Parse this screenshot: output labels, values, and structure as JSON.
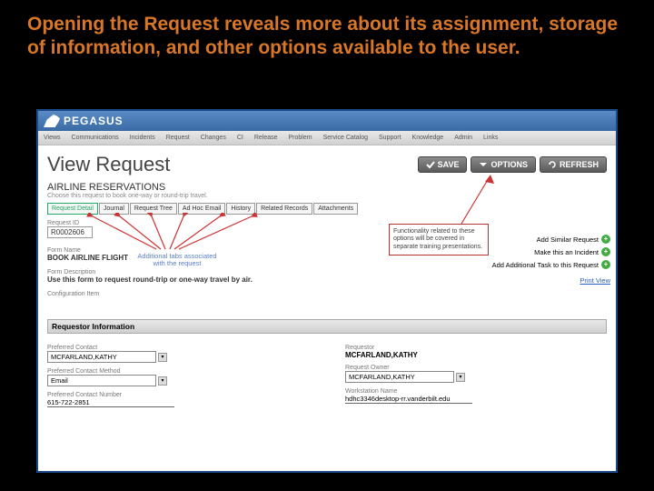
{
  "slide": {
    "title": "Opening the Request reveals more about its assignment, storage of information, and other options available to the user."
  },
  "logo": {
    "text": "PEGASUS"
  },
  "nav": [
    "Views",
    "Communications",
    "Incidents",
    "Request",
    "Changes",
    "CI",
    "Release",
    "Problem",
    "Service Catalog",
    "Support",
    "Knowledge",
    "Admin",
    "Links"
  ],
  "page": {
    "title": "View Request"
  },
  "buttons": {
    "save": "SAVE",
    "options": "OPTIONS",
    "refresh": "REFRESH"
  },
  "section": {
    "title": "AIRLINE RESERVATIONS",
    "sub": "Choose this request to book one-way or round-trip travel."
  },
  "tabs": [
    "Request Detail",
    "Journal",
    "Request Tree",
    "Ad Hoc Email",
    "History",
    "Related Records",
    "Attachments"
  ],
  "fields": {
    "request_id_label": "Request ID",
    "request_id": "R0002606",
    "form_name_label": "Form Name",
    "form_name": "BOOK AIRLINE FLIGHT",
    "form_desc_label": "Form Description",
    "form_desc": "Use this form to request round-trip or one-way travel by air.",
    "config_item_label": "Configuration Item"
  },
  "annot": {
    "tabs_note": "Additional tabs associated with the request"
  },
  "callout": {
    "text": "Functionality related to these options will be covered in separate training presentations."
  },
  "side": {
    "similar": "Add Similar Request",
    "incident": "Make this an Incident",
    "task": "Add Additional Task to this Request",
    "print": "Print View"
  },
  "req_info": {
    "header": "Requestor Information"
  },
  "left_col": {
    "pref_contact_label": "Preferred Contact",
    "pref_contact": "MCFARLAND,KATHY",
    "pref_method_label": "Preferred Contact Method",
    "pref_method": "Email",
    "pref_num_label": "Preferred Contact Number",
    "pref_num": "615-722-2851"
  },
  "right_col": {
    "requestor_label": "Requestor",
    "requestor": "MCFARLAND,KATHY",
    "owner_label": "Request Owner",
    "owner": "MCFARLAND,KATHY",
    "wks_label": "Workstation Name",
    "wks": "hdhc3346desktop-rr.vanderbilt.edu"
  }
}
